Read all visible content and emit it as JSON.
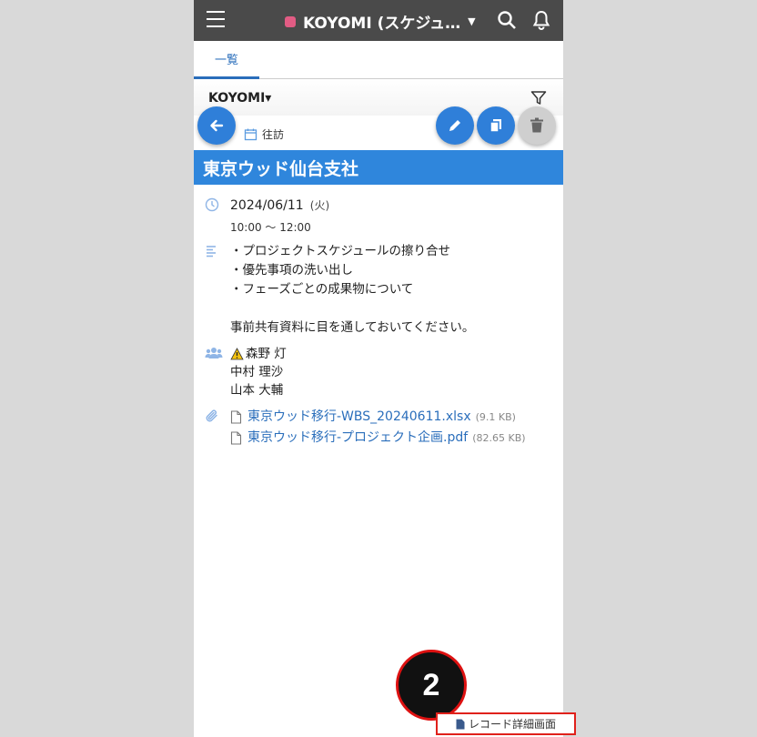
{
  "header": {
    "app_title": "KOYOMI (スケジュ…",
    "menu_icon": "hamburger-icon",
    "search_icon": "search-icon",
    "bell_icon": "bell-icon"
  },
  "tabs": [
    {
      "label": "一覧"
    }
  ],
  "view": {
    "name": "KOYOMI▾"
  },
  "record": {
    "category": "往訪",
    "title": "東京ウッド仙台支社",
    "date": "2024/06/11",
    "weekday": "(火)",
    "time": "10:00 ～ 12:00",
    "note": "・プロジェクトスケジュールの擦り合せ\n・優先事項の洗い出し\n・フェーズごとの成果物について\n\n事前共有資料に目を通しておいてください。",
    "members": [
      "森野 灯",
      "中村 理沙",
      "山本 大輔"
    ],
    "attachments": [
      {
        "name": "東京ウッド移行-WBS_20240611.xlsx",
        "size": "(9.1 KB)"
      },
      {
        "name": "東京ウッド移行-プロジェクト企画.pdf",
        "size": "(82.65 KB)"
      }
    ]
  },
  "annotation": {
    "marker": "2",
    "link_label": "レコード詳細画面"
  },
  "colors": {
    "accent": "#2f7fd9",
    "title_bar": "#2f86dc",
    "topbar": "#4a4a4a",
    "highlight": "#e0211b"
  }
}
